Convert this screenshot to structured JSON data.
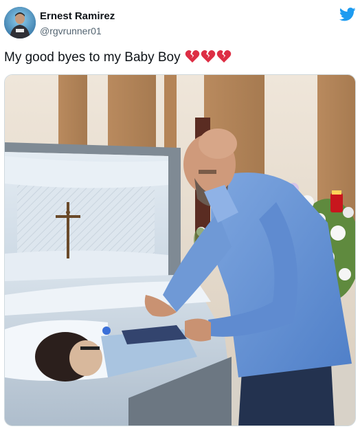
{
  "tweet": {
    "display_name": "Ernest Ramirez",
    "handle": "@rgvrunner01",
    "text": "My good byes to my Baby Boy",
    "emoji": [
      "broken-heart",
      "broken-heart",
      "broken-heart"
    ]
  },
  "colors": {
    "twitter_blue": "#1d9bf0",
    "broken_heart_red": "#dd2e44",
    "handle_gray": "#536471"
  },
  "icons": {
    "brand": "twitter-bird-icon",
    "emoji": "broken-heart-icon"
  },
  "media": {
    "kind": "photo"
  }
}
